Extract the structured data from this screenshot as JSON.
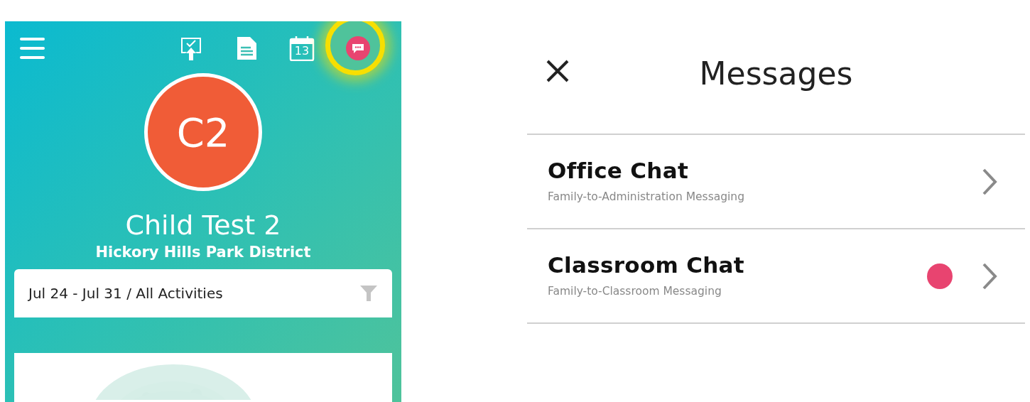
{
  "child_view": {
    "toolbar": [
      {
        "kind": "upload",
        "highlighted": false
      },
      {
        "kind": "document",
        "highlighted": false
      },
      {
        "kind": "calendar",
        "highlighted": false,
        "label": "13"
      },
      {
        "kind": "chat",
        "highlighted": true
      }
    ],
    "avatar": {
      "initials": "C2"
    },
    "child_name": "Child Test 2",
    "organization": "Hickory Hills Park District",
    "filter": {
      "text": "Jul 24 - Jul 31 / All Activities"
    }
  },
  "messages": {
    "title": "Messages",
    "chats": [
      {
        "title": "Office Chat",
        "subtitle": "Family-to-Administration Messaging",
        "unread": false
      },
      {
        "title": "Classroom Chat",
        "subtitle": "Family-to-Classroom Messaging",
        "unread": true
      }
    ]
  }
}
